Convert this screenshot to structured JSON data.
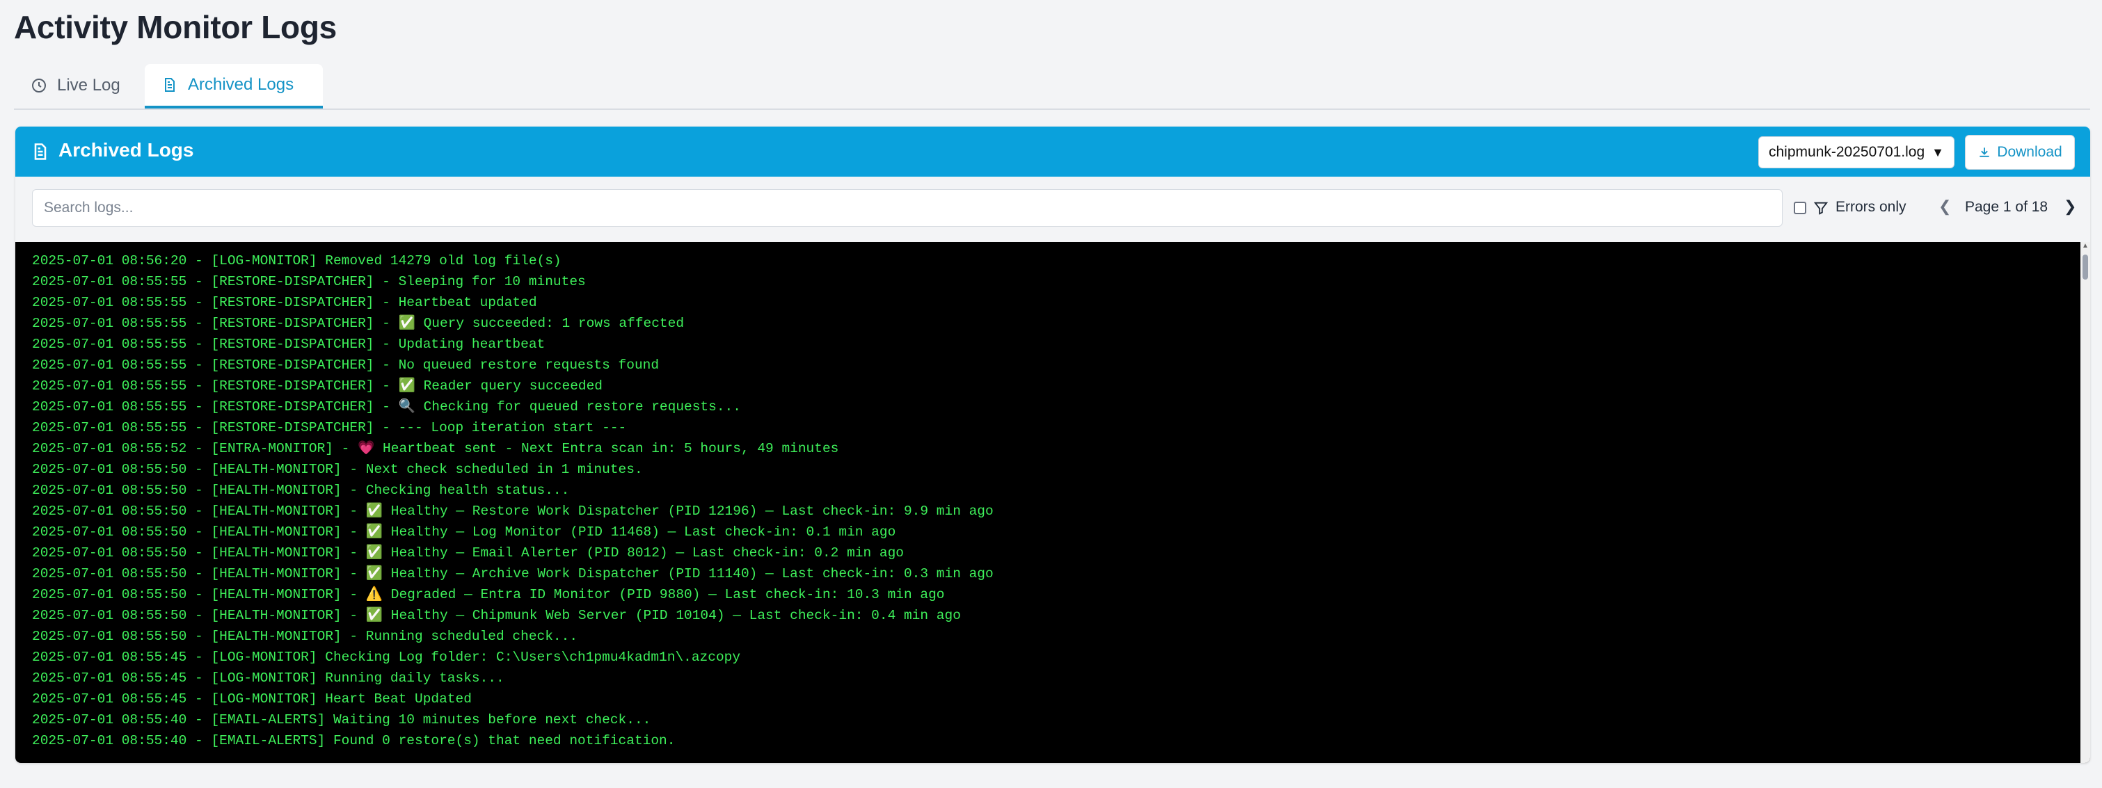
{
  "page": {
    "title": "Activity Monitor Logs"
  },
  "tabs": {
    "live": {
      "label": "Live Log",
      "icon": "clock-icon"
    },
    "archived": {
      "label": "Archived Logs",
      "icon": "document-icon",
      "active": true
    }
  },
  "panel": {
    "title": "Archived Logs",
    "header_color": "#0aa1dc",
    "selected_file": "chipmunk-20250701.log",
    "download_label": "Download"
  },
  "toolbar": {
    "search_placeholder": "Search logs...",
    "errors_only_label": "Errors only",
    "errors_only_checked": false,
    "page_label": "Page 1 of 18"
  },
  "log": {
    "text_color": "#3ef05a",
    "lines": [
      "2025-07-01 08:56:20 - [LOG-MONITOR] Removed 14279 old log file(s)",
      "2025-07-01 08:55:55 - [RESTORE-DISPATCHER] - Sleeping for 10 minutes",
      "2025-07-01 08:55:55 - [RESTORE-DISPATCHER] - Heartbeat updated",
      "2025-07-01 08:55:55 - [RESTORE-DISPATCHER] - ✅ Query succeeded: 1 rows affected",
      "2025-07-01 08:55:55 - [RESTORE-DISPATCHER] - Updating heartbeat",
      "2025-07-01 08:55:55 - [RESTORE-DISPATCHER] - No queued restore requests found",
      "2025-07-01 08:55:55 - [RESTORE-DISPATCHER] - ✅ Reader query succeeded",
      "2025-07-01 08:55:55 - [RESTORE-DISPATCHER] - 🔍 Checking for queued restore requests...",
      "2025-07-01 08:55:55 - [RESTORE-DISPATCHER] - --- Loop iteration start ---",
      "2025-07-01 08:55:52 - [ENTRA-MONITOR] - 💗 Heartbeat sent - Next Entra scan in: 5 hours, 49 minutes",
      "2025-07-01 08:55:50 - [HEALTH-MONITOR] - Next check scheduled in 1 minutes.",
      "2025-07-01 08:55:50 - [HEALTH-MONITOR] - Checking health status...",
      "2025-07-01 08:55:50 - [HEALTH-MONITOR] - ✅ Healthy — Restore Work Dispatcher (PID 12196) — Last check-in: 9.9 min ago",
      "2025-07-01 08:55:50 - [HEALTH-MONITOR] - ✅ Healthy — Log Monitor (PID 11468) — Last check-in: 0.1 min ago",
      "2025-07-01 08:55:50 - [HEALTH-MONITOR] - ✅ Healthy — Email Alerter (PID 8012) — Last check-in: 0.2 min ago",
      "2025-07-01 08:55:50 - [HEALTH-MONITOR] - ✅ Healthy — Archive Work Dispatcher (PID 11140) — Last check-in: 0.3 min ago",
      "2025-07-01 08:55:50 - [HEALTH-MONITOR] - ⚠️ Degraded — Entra ID Monitor (PID 9880) — Last check-in: 10.3 min ago",
      "2025-07-01 08:55:50 - [HEALTH-MONITOR] - ✅ Healthy — Chipmunk Web Server (PID 10104) — Last check-in: 0.4 min ago",
      "2025-07-01 08:55:50 - [HEALTH-MONITOR] - Running scheduled check...",
      "2025-07-01 08:55:45 - [LOG-MONITOR] Checking Log folder: C:\\Users\\ch1pmu4kadm1n\\.azcopy",
      "2025-07-01 08:55:45 - [LOG-MONITOR] Running daily tasks...",
      "2025-07-01 08:55:45 - [LOG-MONITOR] Heart Beat Updated",
      "2025-07-01 08:55:40 - [EMAIL-ALERTS] Waiting 10 minutes before next check...",
      "2025-07-01 08:55:40 - [EMAIL-ALERTS] Found 0 restore(s) that need notification."
    ]
  }
}
